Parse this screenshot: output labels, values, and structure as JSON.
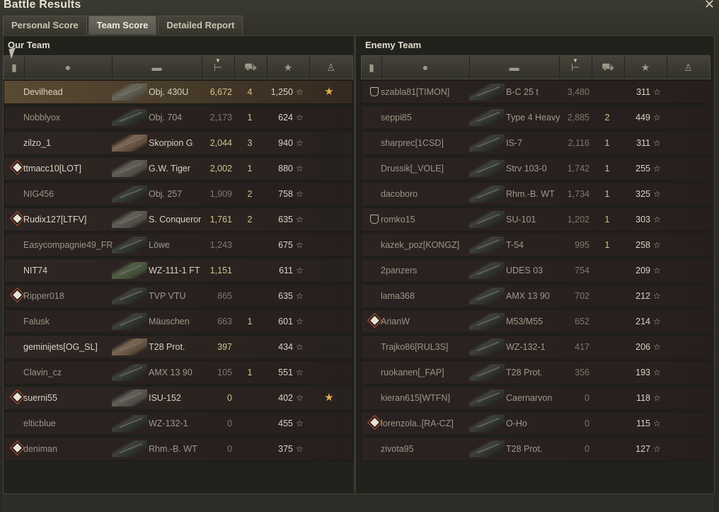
{
  "window": {
    "title": "Battle Results"
  },
  "tabs": [
    {
      "label": "Personal Score"
    },
    {
      "label": "Team Score"
    },
    {
      "label": "Detailed Report"
    }
  ],
  "colors": {
    "accent_damage": "#d6c28a",
    "highlight_row": "#5a4a32",
    "enemy_row": "#2b2321"
  },
  "header_icons": [
    "squad-icon",
    "player-icon",
    "vehicle-icon",
    "damage-icon",
    "kills-icon",
    "xp-star-icon",
    "medal-icon"
  ],
  "our_team": {
    "title": "Our Team",
    "rows": [
      {
        "icon": "",
        "name": "Devilhead",
        "vehicle": "Obj. 430U",
        "damage": "6,672",
        "kills": "4",
        "xp": "1,250",
        "medal": "★",
        "highlight": true,
        "dim": false,
        "tank": "grey"
      },
      {
        "icon": "",
        "name": "Nobblyox",
        "vehicle": "Obj. 704",
        "damage": "2,173",
        "kills": "1",
        "xp": "624",
        "medal": "",
        "highlight": false,
        "dim": true,
        "tank": ""
      },
      {
        "icon": "",
        "name": "zilzo_1",
        "vehicle": "Skorpion G",
        "damage": "2,044",
        "kills": "3",
        "xp": "940",
        "medal": "",
        "highlight": false,
        "dim": false,
        "tank": "light"
      },
      {
        "icon": "diamond",
        "name": "ttmacc10[LOT]",
        "vehicle": "G.W. Tiger",
        "damage": "2,002",
        "kills": "1",
        "xp": "880",
        "medal": "",
        "highlight": false,
        "dim": false,
        "tank": "grey"
      },
      {
        "icon": "",
        "name": "NIG456",
        "vehicle": "Obj. 257",
        "damage": "1,909",
        "kills": "2",
        "xp": "758",
        "medal": "",
        "highlight": false,
        "dim": true,
        "tank": ""
      },
      {
        "icon": "diamond",
        "name": "Rudix127[LTFV]",
        "vehicle": "S. Conqueror",
        "damage": "1,761",
        "kills": "2",
        "xp": "635",
        "medal": "",
        "highlight": false,
        "dim": false,
        "tank": "grey"
      },
      {
        "icon": "",
        "name": "Easycompagnie49_FR",
        "vehicle": "Löwe",
        "damage": "1,243",
        "kills": "",
        "xp": "675",
        "medal": "",
        "highlight": false,
        "dim": true,
        "tank": ""
      },
      {
        "icon": "",
        "name": "NIT74",
        "vehicle": "WZ-111-1 FT",
        "damage": "1,151",
        "kills": "",
        "xp": "611",
        "medal": "",
        "highlight": false,
        "dim": false,
        "tank": "green"
      },
      {
        "icon": "diamond",
        "name": "Ripper018",
        "vehicle": "TVP VTU",
        "damage": "865",
        "kills": "",
        "xp": "635",
        "medal": "",
        "highlight": false,
        "dim": true,
        "tank": ""
      },
      {
        "icon": "",
        "name": "Falusk",
        "vehicle": "Mäuschen",
        "damage": "663",
        "kills": "1",
        "xp": "601",
        "medal": "",
        "highlight": false,
        "dim": true,
        "tank": ""
      },
      {
        "icon": "",
        "name": "geminijets[OG_SL]",
        "vehicle": "T28 Prot.",
        "damage": "397",
        "kills": "",
        "xp": "434",
        "medal": "",
        "highlight": false,
        "dim": false,
        "tank": "light"
      },
      {
        "icon": "",
        "name": "Clavin_cz",
        "vehicle": "AMX 13 90",
        "damage": "105",
        "kills": "1",
        "xp": "551",
        "medal": "",
        "highlight": false,
        "dim": true,
        "tank": ""
      },
      {
        "icon": "diamond",
        "name": "suerni55",
        "vehicle": "ISU-152",
        "damage": "0",
        "kills": "",
        "xp": "402",
        "medal": "★",
        "highlight": false,
        "dim": false,
        "tank": "grey"
      },
      {
        "icon": "",
        "name": "elticblue",
        "vehicle": "WZ-132-1",
        "damage": "0",
        "kills": "",
        "xp": "455",
        "medal": "",
        "highlight": false,
        "dim": true,
        "tank": ""
      },
      {
        "icon": "diamond",
        "name": "deniman",
        "vehicle": "Rhm.-B. WT",
        "damage": "0",
        "kills": "",
        "xp": "375",
        "medal": "",
        "highlight": false,
        "dim": true,
        "tank": ""
      }
    ]
  },
  "enemy_team": {
    "title": "Enemy Team",
    "rows": [
      {
        "icon": "shield",
        "name": "szabla81[TIMON]",
        "vehicle": "B-C 25 t",
        "damage": "3,480",
        "kills": "",
        "xp": "311",
        "medal": "",
        "highlight": false,
        "dim": true,
        "tank": ""
      },
      {
        "icon": "",
        "name": "seppi85",
        "vehicle": "Type 4 Heavy",
        "damage": "2,885",
        "kills": "2",
        "xp": "449",
        "medal": "",
        "highlight": false,
        "dim": true,
        "tank": ""
      },
      {
        "icon": "",
        "name": "sharprec[1CSD]",
        "vehicle": "IS-7",
        "damage": "2,116",
        "kills": "1",
        "xp": "311",
        "medal": "",
        "highlight": false,
        "dim": true,
        "tank": ""
      },
      {
        "icon": "",
        "name": "Drussik[_VOLE]",
        "vehicle": "Strv 103-0",
        "damage": "1,742",
        "kills": "1",
        "xp": "255",
        "medal": "",
        "highlight": false,
        "dim": true,
        "tank": ""
      },
      {
        "icon": "",
        "name": "dacoboro",
        "vehicle": "Rhm.-B. WT",
        "damage": "1,734",
        "kills": "1",
        "xp": "325",
        "medal": "",
        "highlight": false,
        "dim": true,
        "tank": ""
      },
      {
        "icon": "shield",
        "name": "romko15",
        "vehicle": "SU-101",
        "damage": "1,202",
        "kills": "1",
        "xp": "303",
        "medal": "",
        "highlight": false,
        "dim": true,
        "tank": ""
      },
      {
        "icon": "",
        "name": "kazek_poz[KONGZ]",
        "vehicle": "T-54",
        "damage": "995",
        "kills": "1",
        "xp": "258",
        "medal": "",
        "highlight": false,
        "dim": true,
        "tank": ""
      },
      {
        "icon": "",
        "name": "2panzers",
        "vehicle": "UDES 03",
        "damage": "754",
        "kills": "",
        "xp": "209",
        "medal": "",
        "highlight": false,
        "dim": true,
        "tank": ""
      },
      {
        "icon": "",
        "name": "lama368",
        "vehicle": "AMX 13 90",
        "damage": "702",
        "kills": "",
        "xp": "212",
        "medal": "",
        "highlight": false,
        "dim": true,
        "tank": ""
      },
      {
        "icon": "diamond",
        "name": "ArianW",
        "vehicle": "M53/M55",
        "damage": "652",
        "kills": "",
        "xp": "214",
        "medal": "",
        "highlight": false,
        "dim": true,
        "tank": ""
      },
      {
        "icon": "",
        "name": "Trajko86[RUL3S]",
        "vehicle": "WZ-132-1",
        "damage": "417",
        "kills": "",
        "xp": "206",
        "medal": "",
        "highlight": false,
        "dim": true,
        "tank": ""
      },
      {
        "icon": "",
        "name": "ruokanen[_FAP]",
        "vehicle": "T28 Prot.",
        "damage": "356",
        "kills": "",
        "xp": "193",
        "medal": "",
        "highlight": false,
        "dim": true,
        "tank": ""
      },
      {
        "icon": "",
        "name": "kieran615[WTFN]",
        "vehicle": "Caernarvon",
        "damage": "0",
        "kills": "",
        "xp": "118",
        "medal": "",
        "highlight": false,
        "dim": true,
        "tank": ""
      },
      {
        "icon": "diamond",
        "name": "lorenzola..[RA-CZ]",
        "vehicle": "O-Ho",
        "damage": "0",
        "kills": "",
        "xp": "115",
        "medal": "",
        "highlight": false,
        "dim": true,
        "tank": ""
      },
      {
        "icon": "",
        "name": "zivota95",
        "vehicle": "T28 Prot.",
        "damage": "0",
        "kills": "",
        "xp": "127",
        "medal": "",
        "highlight": false,
        "dim": true,
        "tank": ""
      }
    ]
  }
}
